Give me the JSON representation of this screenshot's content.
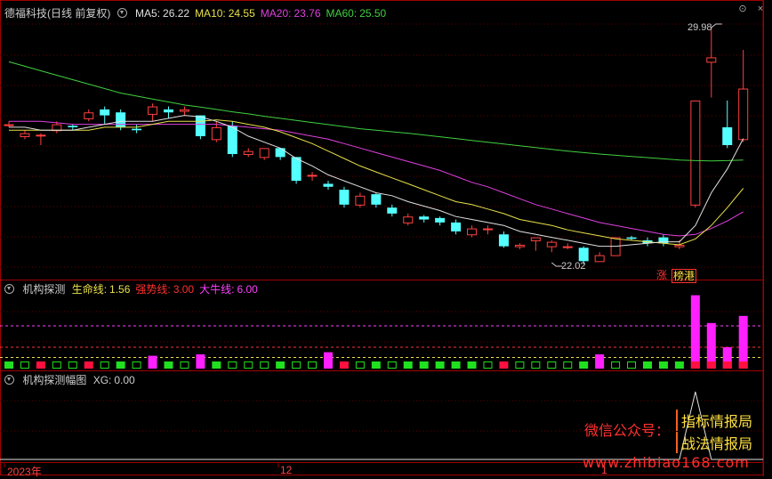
{
  "stock": {
    "title": "德福科技(日线 前复权)",
    "ma_lines": [
      {
        "name": "MA5",
        "value": "26.22",
        "color": "#e0e0e0"
      },
      {
        "name": "MA10",
        "value": "24.55",
        "color": "#e8e04a"
      },
      {
        "name": "MA20",
        "value": "23.76",
        "color": "#e040e0"
      },
      {
        "name": "MA60",
        "value": "25.50",
        "color": "#40d040"
      }
    ],
    "high_label": "29.98",
    "low_label": "22.02",
    "tags": [
      "涨",
      "榜港"
    ]
  },
  "indicator1": {
    "title": "机构探测",
    "lines": [
      {
        "name": "生命线",
        "value": "1.56",
        "color": "#e8e04a"
      },
      {
        "name": "强势线",
        "value": "3.00",
        "color": "#ff3030"
      },
      {
        "name": "大牛线",
        "value": "6.00",
        "color": "#ff40ff"
      }
    ]
  },
  "indicator2": {
    "title": "机构探测幅图",
    "lines": [
      {
        "name": "XG",
        "value": "0.00",
        "color": "#cccccc"
      }
    ]
  },
  "x_axis": {
    "labels": [
      "2023年",
      "12",
      "1"
    ]
  },
  "watermark": {
    "line1": "微信公众号：",
    "tag1": "指标情报局",
    "tag2": "战法情报局",
    "url": "www.zhibiao168.com"
  },
  "chart_data": {
    "type": "candlestick",
    "candles": [
      [
        26.7,
        26.7,
        26.6,
        26.8
      ],
      [
        26.3,
        26.4,
        26.2,
        26.5
      ],
      [
        26.35,
        26.35,
        26.0,
        26.4
      ],
      [
        26.5,
        26.7,
        26.4,
        26.8
      ],
      [
        26.65,
        26.6,
        26.5,
        26.7
      ],
      [
        26.9,
        27.1,
        26.8,
        27.2
      ],
      [
        27.2,
        27.0,
        26.7,
        27.3
      ],
      [
        27.1,
        26.6,
        26.5,
        27.2
      ],
      [
        26.55,
        26.5,
        26.4,
        26.7
      ],
      [
        27.05,
        27.3,
        26.8,
        27.4
      ],
      [
        27.2,
        27.1,
        26.9,
        27.3
      ],
      [
        27.15,
        27.2,
        27.0,
        27.3
      ],
      [
        27.0,
        26.3,
        26.2,
        27.0
      ],
      [
        26.2,
        26.6,
        26.1,
        26.8
      ],
      [
        26.65,
        25.7,
        25.6,
        26.8
      ],
      [
        25.7,
        25.8,
        25.6,
        25.9
      ],
      [
        25.6,
        25.9,
        25.5,
        25.9
      ],
      [
        25.9,
        25.6,
        25.5,
        25.8
      ],
      [
        25.6,
        24.8,
        24.7,
        25.6
      ],
      [
        25.0,
        25.0,
        24.8,
        25.1
      ],
      [
        24.7,
        24.6,
        24.5,
        24.8
      ],
      [
        24.5,
        24.0,
        23.9,
        24.6
      ],
      [
        24.0,
        24.3,
        23.9,
        24.4
      ],
      [
        24.35,
        24.0,
        23.9,
        24.4
      ],
      [
        23.9,
        23.7,
        23.6,
        24.0
      ],
      [
        23.4,
        23.6,
        23.3,
        23.7
      ],
      [
        23.6,
        23.5,
        23.4,
        23.65
      ],
      [
        23.55,
        23.4,
        23.3,
        23.6
      ],
      [
        23.4,
        23.1,
        23.0,
        23.5
      ],
      [
        23.0,
        23.2,
        22.9,
        23.3
      ],
      [
        23.2,
        23.2,
        23.0,
        23.3
      ],
      [
        23.0,
        22.6,
        22.55,
        23.1
      ],
      [
        22.6,
        22.65,
        22.5,
        22.7
      ],
      [
        22.8,
        22.9,
        22.45,
        22.9
      ],
      [
        22.6,
        22.75,
        22.4,
        22.8
      ],
      [
        22.6,
        22.6,
        22.5,
        22.7
      ],
      [
        22.55,
        22.1,
        22.0,
        22.6
      ],
      [
        22.1,
        22.3,
        22.1,
        22.4
      ],
      [
        22.3,
        22.9,
        22.3,
        22.9
      ],
      [
        22.9,
        22.85,
        22.8,
        22.95
      ],
      [
        22.8,
        22.7,
        22.6,
        22.9
      ],
      [
        22.9,
        22.7,
        22.6,
        23.0
      ],
      [
        22.6,
        22.65,
        22.5,
        22.8
      ],
      [
        24.0,
        27.5,
        23.9,
        27.5
      ],
      [
        28.8,
        28.95,
        27.6,
        29.98
      ],
      [
        26.6,
        26.0,
        25.9,
        27.5
      ],
      [
        26.2,
        27.9,
        26.1,
        29.2
      ]
    ],
    "ma5": [
      26.6,
      26.6,
      26.5,
      26.5,
      26.5,
      26.6,
      26.7,
      26.8,
      26.8,
      26.8,
      26.9,
      27.0,
      26.95,
      26.8,
      26.6,
      26.3,
      26.1,
      25.9,
      25.55,
      25.3,
      25.0,
      24.8,
      24.6,
      24.4,
      24.3,
      24.1,
      23.95,
      23.8,
      23.6,
      23.5,
      23.4,
      23.3,
      23.1,
      23.0,
      22.9,
      22.8,
      22.7,
      22.6,
      22.6,
      22.65,
      22.7,
      22.75,
      22.75,
      23.3,
      24.4,
      25.2,
      26.22
    ],
    "ma10": [
      26.5,
      26.5,
      26.5,
      26.5,
      26.5,
      26.5,
      26.6,
      26.6,
      26.6,
      26.7,
      26.8,
      26.8,
      26.8,
      26.85,
      26.8,
      26.7,
      26.6,
      26.45,
      26.25,
      26.05,
      25.8,
      25.55,
      25.3,
      25.1,
      24.9,
      24.7,
      24.5,
      24.3,
      24.1,
      24.0,
      23.85,
      23.7,
      23.5,
      23.4,
      23.3,
      23.15,
      23.05,
      22.95,
      22.85,
      22.8,
      22.75,
      22.7,
      22.65,
      22.85,
      23.3,
      23.9,
      24.55
    ],
    "ma20": [
      26.8,
      26.8,
      26.8,
      26.75,
      26.7,
      26.7,
      26.7,
      26.7,
      26.7,
      26.7,
      26.7,
      26.7,
      26.7,
      26.7,
      26.65,
      26.6,
      26.55,
      26.5,
      26.4,
      26.3,
      26.2,
      26.05,
      25.9,
      25.75,
      25.6,
      25.45,
      25.3,
      25.15,
      24.95,
      24.75,
      24.6,
      24.4,
      24.2,
      24.0,
      23.85,
      23.7,
      23.55,
      23.4,
      23.3,
      23.2,
      23.1,
      23.0,
      22.95,
      23.0,
      23.2,
      23.45,
      23.76
    ],
    "ma60": [
      28.8,
      28.65,
      28.5,
      28.35,
      28.2,
      28.05,
      27.9,
      27.75,
      27.65,
      27.55,
      27.45,
      27.35,
      27.28,
      27.2,
      27.12,
      27.05,
      26.97,
      26.9,
      26.83,
      26.76,
      26.69,
      26.62,
      26.55,
      26.5,
      26.45,
      26.4,
      26.34,
      26.28,
      26.22,
      26.16,
      26.1,
      26.04,
      25.98,
      25.92,
      25.86,
      25.8,
      25.75,
      25.7,
      25.66,
      25.62,
      25.58,
      25.54,
      25.5,
      25.48,
      25.47,
      25.48,
      25.5
    ],
    "ind1_levels": {
      "生命线": 1.56,
      "强势线": 3.0,
      "大牛线": 6.0
    },
    "ind1_bars": [
      [
        1,
        "g"
      ],
      [
        1,
        "o"
      ],
      [
        1,
        "r"
      ],
      [
        1,
        "o"
      ],
      [
        1,
        "o"
      ],
      [
        1,
        "r"
      ],
      [
        1,
        "o"
      ],
      [
        1,
        "g"
      ],
      [
        1,
        "o"
      ],
      [
        1.8,
        "m"
      ],
      [
        1,
        "g"
      ],
      [
        1,
        "o"
      ],
      [
        2,
        "m"
      ],
      [
        1,
        "g"
      ],
      [
        1,
        "o"
      ],
      [
        1,
        "o"
      ],
      [
        1,
        "o"
      ],
      [
        1,
        "g"
      ],
      [
        1,
        "o"
      ],
      [
        1,
        "o"
      ],
      [
        2.3,
        "m"
      ],
      [
        1,
        "r"
      ],
      [
        1,
        "o"
      ],
      [
        1,
        "g"
      ],
      [
        1,
        "o"
      ],
      [
        1,
        "g"
      ],
      [
        1,
        "g"
      ],
      [
        1,
        "g"
      ],
      [
        1,
        "g"
      ],
      [
        1,
        "g"
      ],
      [
        1,
        "o"
      ],
      [
        1,
        "r"
      ],
      [
        1,
        "o"
      ],
      [
        1,
        "o"
      ],
      [
        1,
        "o"
      ],
      [
        1,
        "o"
      ],
      [
        1,
        "g"
      ],
      [
        2,
        "m"
      ],
      [
        1,
        "o"
      ],
      [
        1,
        "o"
      ],
      [
        1,
        "g"
      ],
      [
        1,
        "g"
      ],
      [
        1,
        "g"
      ],
      [
        10.3,
        "m"
      ],
      [
        6.4,
        "m"
      ],
      [
        3,
        "m"
      ],
      [
        7.4,
        "m"
      ]
    ],
    "ind2_peak_index": 43
  }
}
